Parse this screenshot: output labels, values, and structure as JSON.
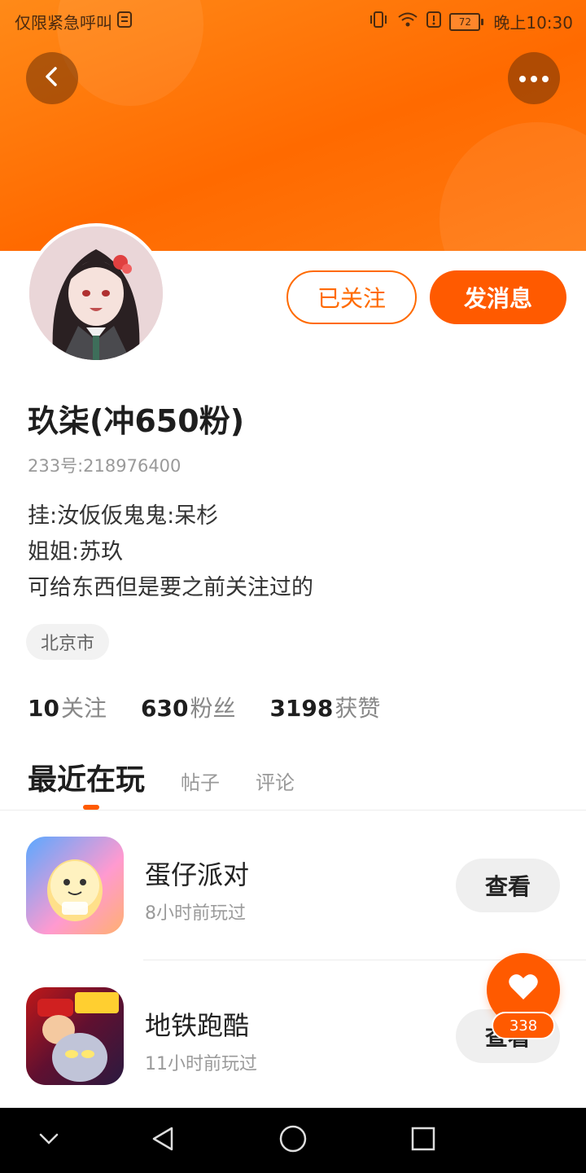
{
  "status_bar": {
    "carrier_text": "仅限紧急呼叫",
    "battery": "72",
    "time": "晚上10:30"
  },
  "header": {
    "accent_color": "#ff6a00",
    "back_icon": "chevron-left-icon",
    "more_icon": "more-dots-icon"
  },
  "profile": {
    "follow_button": "已关注",
    "message_button": "发消息",
    "name": "玖柒(冲650粉)",
    "uid": "233号:218976400",
    "bio": [
      "挂:汝仮仮鬼鬼:呆杉",
      "姐姐:苏玖",
      "可给东西但是要之前关注过的"
    ],
    "location": "北京市"
  },
  "stats": [
    {
      "value": "10",
      "label": "关注"
    },
    {
      "value": "630",
      "label": "粉丝"
    },
    {
      "value": "3198",
      "label": "获赞"
    }
  ],
  "tabs": {
    "active": "最近在玩",
    "items": [
      "帖子",
      "评论"
    ]
  },
  "games": [
    {
      "title": "蛋仔派对",
      "subtitle": "8小时前玩过",
      "button": "查看"
    },
    {
      "title": "地铁跑酷",
      "subtitle": "11小时前玩过",
      "button": "查看"
    }
  ],
  "like": {
    "count": "338"
  }
}
